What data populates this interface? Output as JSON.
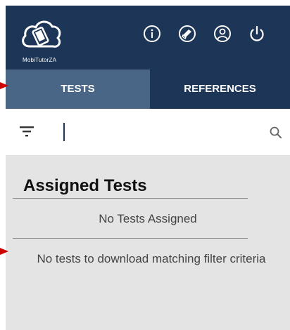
{
  "app": {
    "logo_text": "MobiTutorZA"
  },
  "header": {
    "icons": [
      "info-icon",
      "book-icon",
      "profile-icon",
      "power-icon"
    ]
  },
  "tabs": [
    {
      "label": "TESTS",
      "active": true
    },
    {
      "label": "REFERENCES",
      "active": false
    }
  ],
  "search": {
    "value": "",
    "placeholder": ""
  },
  "assigned": {
    "title": "Assigned Tests",
    "empty_message": "No Tests Assigned"
  },
  "download": {
    "message": "No tests to download matching filter criteria"
  },
  "colors": {
    "header": "#1d3557",
    "active_tab": "#4a6687",
    "content_bg": "#e4e4e4",
    "annotation_arrow": "#cc0000"
  }
}
